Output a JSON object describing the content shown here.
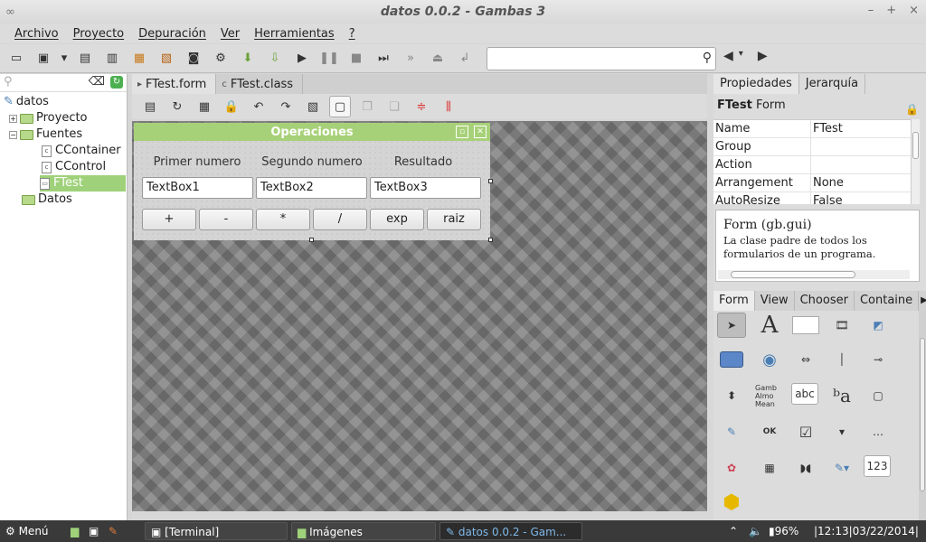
{
  "window": {
    "title": "datos 0.0.2 - Gambas 3",
    "controls": [
      "–",
      "+",
      "×"
    ]
  },
  "menu": [
    "Archivo",
    "Proyecto",
    "Depuración",
    "Ver",
    "Herramientas",
    "?"
  ],
  "toolbar_icons": [
    "new-project-icon",
    "open-project-icon",
    "dropdown-icon",
    "save-icon",
    "save-as-icon",
    "properties-icon",
    "edit-icon",
    "make-icon",
    "settings-icon",
    "compile-icon",
    "compile-all-icon",
    "play-icon",
    "pause-icon",
    "stop-icon",
    "step-icon",
    "step-over-icon",
    "eject-icon",
    "return-icon"
  ],
  "search": {
    "value": "",
    "placeholder": ""
  },
  "tree": {
    "items": [
      {
        "label": "datos"
      },
      {
        "label": "Proyecto"
      },
      {
        "label": "Fuentes"
      },
      {
        "label": "CContainer"
      },
      {
        "label": "CControl"
      },
      {
        "label": "FTest"
      },
      {
        "label": "Datos"
      }
    ]
  },
  "editor_tabs": [
    {
      "label": "FTest.form"
    },
    {
      "label": "FTest.class"
    }
  ],
  "form": {
    "title": "Operaciones",
    "labels": [
      "Primer numero",
      "Segundo numero",
      "Resultado"
    ],
    "textboxes": [
      "TextBox1",
      "TextBox2",
      "TextBox3"
    ],
    "buttons": [
      "+",
      "-",
      "*",
      "/",
      "exp",
      "raiz"
    ]
  },
  "properties": {
    "tabs": [
      "Propiedades",
      "Jerarquía"
    ],
    "object_name": "FTest",
    "object_class": "Form",
    "rows": [
      {
        "name": "Name",
        "value": "FTest"
      },
      {
        "name": "Group",
        "value": ""
      },
      {
        "name": "Action",
        "value": ""
      },
      {
        "name": "Arrangement",
        "value": "None"
      },
      {
        "name": "AutoResize",
        "value": "False"
      }
    ],
    "help_title": "Form (gb.gui)",
    "help_text": "La clase padre de todos los formularios de un programa."
  },
  "toolbox": {
    "tabs": [
      "Form",
      "View",
      "Chooser",
      "Containe"
    ],
    "items": [
      "abc",
      "123",
      "OK",
      "A",
      "Gamb Almo Mean"
    ]
  },
  "taskbar": {
    "menu_label": "Menú",
    "tasks": [
      {
        "label": "[Terminal]"
      },
      {
        "label": "Imágenes"
      },
      {
        "label": "datos 0.0.2 - Gam..."
      }
    ],
    "battery": "96%",
    "clock": "|12:13|03/22/2014|"
  }
}
